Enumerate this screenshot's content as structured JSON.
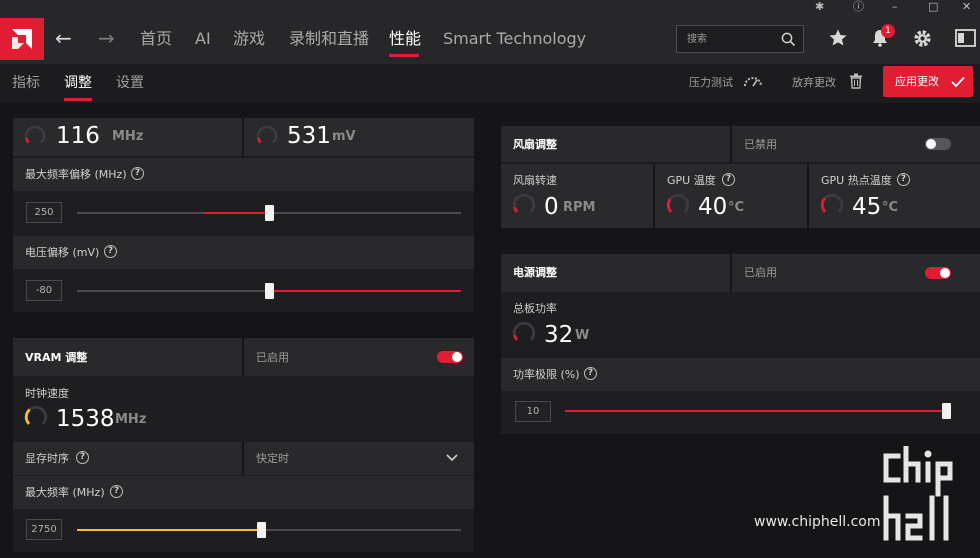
{
  "colors": {
    "accent": "#e01d33",
    "vram_accent": "#f5c023",
    "panel": "#1e1e20",
    "row": "#2a2a2c"
  },
  "window": {
    "icons": [
      "bug-icon",
      "help-icon",
      "minimize-icon",
      "restore-icon",
      "close-icon"
    ]
  },
  "nav": {
    "tabs": [
      {
        "label": "首页",
        "active": false
      },
      {
        "label": "AI",
        "active": false
      },
      {
        "label": "游戏",
        "active": false
      },
      {
        "label": "录制和直播",
        "active": false
      },
      {
        "label": "性能",
        "active": true
      },
      {
        "label": "Smart Technology",
        "active": false
      }
    ],
    "search_placeholder": "搜索",
    "notification_count": "1"
  },
  "subnav": {
    "tabs": [
      {
        "label": "指标",
        "active": false
      },
      {
        "label": "调整",
        "active": true
      },
      {
        "label": "设置",
        "active": false
      }
    ],
    "stress_test": "压力测试",
    "discard": "放弃更改",
    "apply": "应用更改"
  },
  "gpu_tuning": {
    "clock": {
      "value": "116",
      "unit": "MHz",
      "gauge_fraction": 0.05
    },
    "voltage": {
      "value": "531",
      "unit": "mV",
      "gauge_fraction": 0.05
    },
    "max_freq_offset": {
      "label": "最大频率偏移 (MHz)",
      "value": "250",
      "slider_fraction": 0.5,
      "fill_start_fraction": 0.33
    },
    "voltage_offset": {
      "label": "电压偏移 (mV)",
      "value": "-80",
      "slider_fraction": 0.5,
      "fill_start_fraction": 0.5
    }
  },
  "vram": {
    "title": "VRAM 调整",
    "status": "已启用",
    "enabled": true,
    "clock_label": "时钟速度",
    "clock": {
      "value": "1538",
      "unit": "MHz",
      "gauge_fraction": 0.35
    },
    "timing_label": "显存时序",
    "timing_value": "快定时",
    "max_freq_label": "最大频率 (MHz)",
    "max_freq_value": "2750",
    "slider_fraction": 0.48
  },
  "fan": {
    "title": "风扇调整",
    "status": "已禁用",
    "enabled": false,
    "fan_speed": {
      "label": "风扇转速",
      "value": "0",
      "unit": "RPM",
      "gauge_fraction": 0.0
    },
    "gpu_temp": {
      "label": "GPU 温度",
      "value": "40",
      "unit": "°C",
      "gauge_fraction": 0.3
    },
    "hotspot_temp": {
      "label": "GPU 热点温度",
      "value": "45",
      "unit": "°C",
      "gauge_fraction": 0.33
    }
  },
  "power": {
    "title": "电源调整",
    "status": "已启用",
    "enabled": true,
    "board_power": {
      "label": "总板功率",
      "value": "32",
      "unit": "W",
      "gauge_fraction": 0.05
    },
    "power_limit": {
      "label": "功率极限 (%)",
      "value": "10",
      "slider_fraction": 1.0
    }
  },
  "watermark": "www.chiphell.com"
}
